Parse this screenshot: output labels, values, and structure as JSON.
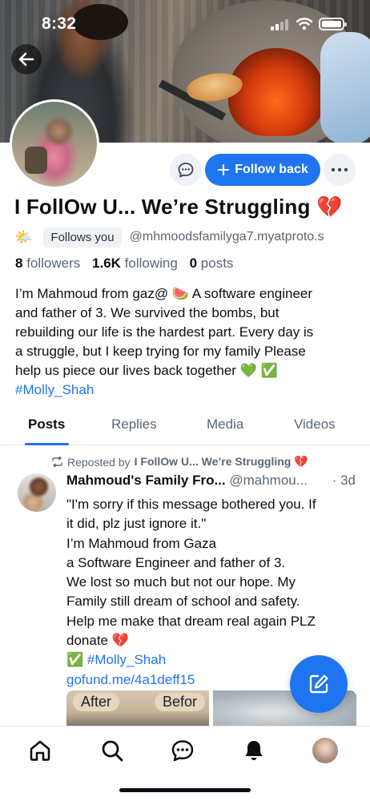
{
  "status_bar": {
    "time": "8:32"
  },
  "profile": {
    "display_name": "I FollOw U... We’re Struggling 💔",
    "sun_emoji": "🌤️",
    "follows_you": "Follows you",
    "handle": "@mhmoodsfamilyga7.myatproto.s",
    "follow_label": "Follow back",
    "stats": {
      "followers_count": "8",
      "followers_label": "followers",
      "following_count": "1.6K",
      "following_label": "following",
      "posts_count": "0",
      "posts_label": "posts"
    },
    "bio_line1": "I’m Mahmoud from gaz@ 🍉 A software engineer",
    "bio_line2": "and father of 3. We survived the bombs, but",
    "bio_line3": "rebuilding our life is the hardest part. Every day is",
    "bio_line4": "a struggle, but I keep trying for my family Please",
    "bio_line5": "help us piece our lives back together 💚 ✅",
    "bio_hashtag": "#Molly_Shah"
  },
  "tabs": [
    "Posts",
    "Replies",
    "Media",
    "Videos"
  ],
  "post": {
    "repost_prefix": "Reposted by",
    "repost_name": "I FollOw U... We’re Struggling 💔",
    "author_name": "Mahmoud's Family Fro...",
    "author_handle": "@mahmou...",
    "time": "· 3d",
    "line1": "\"I'm sorry if this message bothered you. If",
    "line2": "it did, plz just ignore it.\"",
    "line3": "I’m Mahmoud from Gaza",
    "line4": "a Software Engineer and father of 3.",
    "line5": "We lost so much but not our hope. My",
    "line6": "Family still dream of school and safety.",
    "line7": "Help me make that dream real again PLZ",
    "line8": "donate 💔",
    "hashtag_line": "✅ #Molly_Shah",
    "link": "gofund.me/4a1deff15",
    "image_label_after": "After",
    "image_label_before": "Befor"
  },
  "colors": {
    "accent": "#1f74f0",
    "muted": "#5b6672",
    "text": "#0b0f14"
  },
  "icons": [
    "back-arrow-icon",
    "message-icon",
    "plus-icon",
    "more-icon",
    "repost-icon",
    "compose-icon",
    "home-icon",
    "search-icon",
    "chat-icon",
    "bell-icon"
  ]
}
